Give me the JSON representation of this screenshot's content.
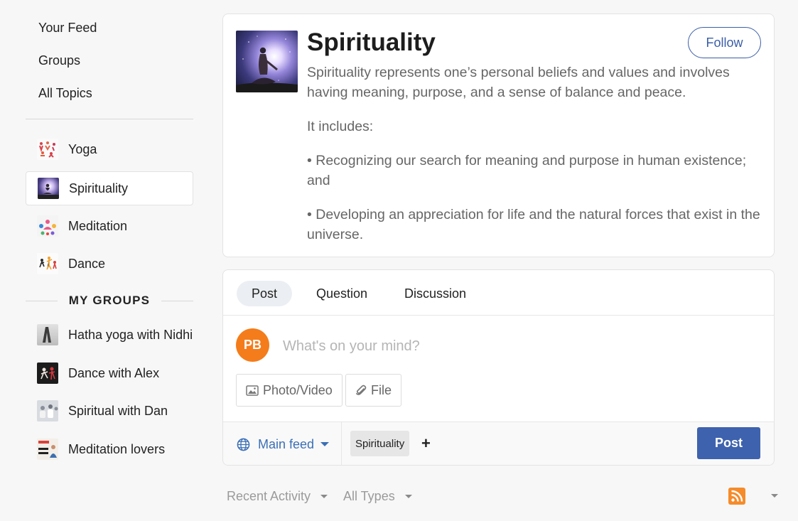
{
  "sidebar": {
    "nav": [
      "Your Feed",
      "Groups",
      "All Topics"
    ],
    "topics": [
      {
        "label": "Yoga",
        "icon": "yoga-thumbnail"
      },
      {
        "label": "Spirituality",
        "icon": "spirituality-thumbnail",
        "active": true
      },
      {
        "label": "Meditation",
        "icon": "meditation-thumbnail"
      },
      {
        "label": "Dance",
        "icon": "dance-thumbnail"
      }
    ],
    "my_groups_label": "MY GROUPS",
    "groups": [
      {
        "label": "Hatha yoga with Nidhi",
        "icon": "hatha-yoga-thumbnail"
      },
      {
        "label": "Dance with Alex",
        "icon": "dance-group-thumbnail"
      },
      {
        "label": "Spiritual with Dan",
        "icon": "spiritual-group-thumbnail"
      },
      {
        "label": "Meditation lovers",
        "icon": "meditation-group-thumbnail"
      }
    ]
  },
  "topic": {
    "title": "Spirituality",
    "follow_label": "Follow",
    "description": [
      "Spirituality represents one’s personal beliefs and values and involves having meaning, purpose, and a sense of balance and peace.",
      "It includes:",
      "• Recognizing our search for meaning and purpose in human existence; and",
      "• Developing an appreciation for life and the natural forces that exist in the universe."
    ]
  },
  "composer": {
    "tabs": [
      {
        "label": "Post",
        "active": true
      },
      {
        "label": "Question"
      },
      {
        "label": "Discussion"
      }
    ],
    "avatar_initials": "PB",
    "placeholder": "What's on your mind?",
    "photo_video_label": "Photo/Video",
    "file_label": "File",
    "feed_label": "Main feed",
    "tag": "Spirituality",
    "add_tag": "+",
    "post_label": "Post"
  },
  "filters": {
    "activity_label": "Recent Activity",
    "types_label": "All Types"
  },
  "colors": {
    "accent": "#3e62ad",
    "link": "#3b6fb6",
    "avatar": "#f47c1b",
    "rss": "#f58b2a"
  }
}
